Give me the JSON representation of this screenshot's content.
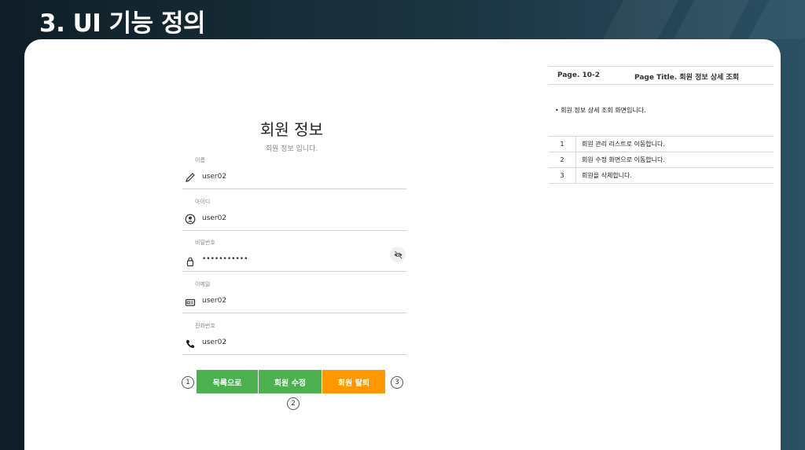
{
  "slide": {
    "title": "3. UI 기능 정의"
  },
  "form": {
    "title": "회원 정보",
    "subtitle": "회원 정보 입니다.",
    "fields": [
      {
        "label": "이름",
        "value": "user02",
        "icon": "pencil-icon"
      },
      {
        "label": "아이디",
        "value": "user02",
        "icon": "user-icon"
      },
      {
        "label": "비밀번호",
        "value": "•••••••••••",
        "icon": "lock-icon"
      },
      {
        "label": "이메일",
        "value": "user02",
        "icon": "id-card-icon"
      },
      {
        "label": "전화번호",
        "value": "user02",
        "icon": "phone-icon"
      }
    ],
    "buttons": {
      "list": "목록으로",
      "edit": "회원 수정",
      "delete": "회원 탈퇴"
    },
    "markers": [
      "1",
      "2",
      "3"
    ],
    "colors": {
      "primary": "#4caf50",
      "warning": "#ff9800"
    }
  },
  "description": {
    "page": "Page. 10-2",
    "page_title": "Page Title. 회원 정보 상세 조회",
    "note": "회원 정보 상세 조회 화면입니다.",
    "rows": [
      {
        "num": "1",
        "text": "회원 관리 리스트로 이동합니다."
      },
      {
        "num": "2",
        "text": "회원 수정 화면으로 이동합니다."
      },
      {
        "num": "3",
        "text": "회원을 삭제합니다."
      }
    ]
  }
}
